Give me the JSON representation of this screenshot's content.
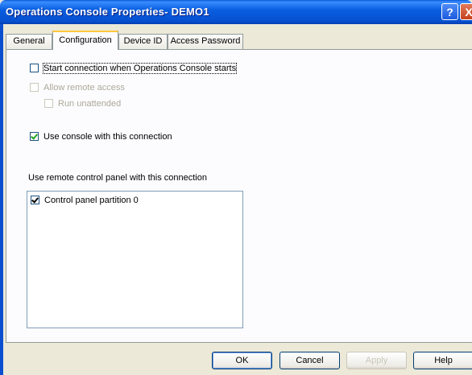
{
  "window": {
    "title": "Operations Console Properties- DEMO1",
    "help_glyph": "?",
    "close_glyph": "X"
  },
  "tabs": [
    {
      "label": "General"
    },
    {
      "label": "Configuration"
    },
    {
      "label": "Device ID"
    },
    {
      "label": "Access Password"
    }
  ],
  "config": {
    "start_connection": {
      "label": "Start connection when Operations Console starts",
      "checked": false
    },
    "allow_remote": {
      "label": "Allow remote access",
      "checked": false,
      "disabled": true
    },
    "run_unattended": {
      "label": "Run unattended",
      "checked": false,
      "disabled": true
    },
    "use_console": {
      "label": "Use console with this connection",
      "checked": true
    },
    "remote_panel_label": "Use remote control panel with this connection",
    "partitions": [
      {
        "label": "Control panel partition 0",
        "checked": true
      }
    ]
  },
  "buttons": {
    "ok": "OK",
    "cancel": "Cancel",
    "apply": "Apply",
    "help": "Help"
  }
}
